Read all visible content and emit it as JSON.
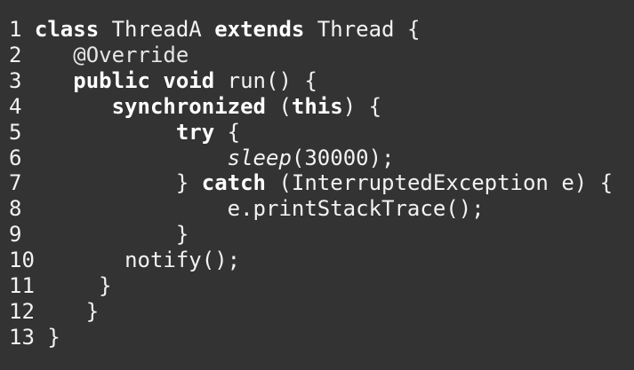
{
  "code": {
    "lines": [
      {
        "num": "1",
        "indent": " ",
        "tokens": [
          {
            "t": "class",
            "s": "kw"
          },
          {
            "t": " ThreadA ",
            "s": ""
          },
          {
            "t": "extends",
            "s": "kw"
          },
          {
            "t": " Thread {",
            "s": ""
          }
        ]
      },
      {
        "num": "2",
        "indent": "    ",
        "tokens": [
          {
            "t": "@Override",
            "s": "ann"
          }
        ]
      },
      {
        "num": "3",
        "indent": "    ",
        "tokens": [
          {
            "t": "public",
            "s": "kw"
          },
          {
            "t": " ",
            "s": ""
          },
          {
            "t": "void",
            "s": "kw"
          },
          {
            "t": " run() {",
            "s": ""
          }
        ]
      },
      {
        "num": "4",
        "indent": "       ",
        "tokens": [
          {
            "t": "synchronized",
            "s": "kw"
          },
          {
            "t": " (",
            "s": ""
          },
          {
            "t": "this",
            "s": "kw"
          },
          {
            "t": ") {",
            "s": ""
          }
        ]
      },
      {
        "num": "5",
        "indent": "            ",
        "tokens": [
          {
            "t": "try",
            "s": "kw"
          },
          {
            "t": " {",
            "s": ""
          }
        ]
      },
      {
        "num": "6",
        "indent": "                ",
        "tokens": [
          {
            "t": "sleep",
            "s": "it"
          },
          {
            "t": "(30000);",
            "s": ""
          }
        ]
      },
      {
        "num": "7",
        "indent": "            ",
        "tokens": [
          {
            "t": "} ",
            "s": ""
          },
          {
            "t": "catch",
            "s": "kw"
          },
          {
            "t": " (InterruptedException e) {",
            "s": ""
          }
        ]
      },
      {
        "num": "8",
        "indent": "                ",
        "tokens": [
          {
            "t": "e.printStackTrace();",
            "s": ""
          }
        ]
      },
      {
        "num": "9",
        "indent": "            ",
        "tokens": [
          {
            "t": "}",
            "s": ""
          }
        ]
      },
      {
        "num": "10",
        "indent": "       ",
        "tokens": [
          {
            "t": "notify();",
            "s": ""
          }
        ]
      },
      {
        "num": "11",
        "indent": "     ",
        "tokens": [
          {
            "t": "}",
            "s": ""
          }
        ]
      },
      {
        "num": "12",
        "indent": "    ",
        "tokens": [
          {
            "t": "}",
            "s": ""
          }
        ]
      },
      {
        "num": "13",
        "indent": " ",
        "tokens": [
          {
            "t": "}",
            "s": ""
          }
        ]
      }
    ]
  }
}
